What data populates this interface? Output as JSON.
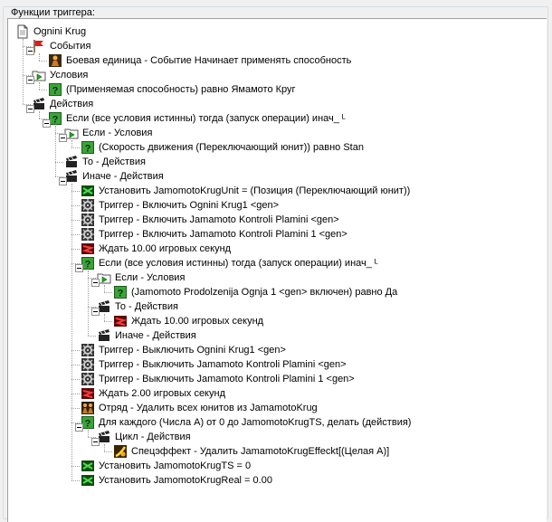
{
  "panel": {
    "title": "Функции триггера:"
  },
  "tree": [
    {
      "level": 0,
      "icon": "document-icon",
      "label": "Ognini Krug",
      "expandable": false
    },
    {
      "level": 1,
      "icon": "flag-icon",
      "label": "События",
      "expandable": true
    },
    {
      "level": 2,
      "icon": "unit-icon",
      "label": "Боевая единица - Событие Начинает применять способность",
      "expandable": false
    },
    {
      "level": 1,
      "icon": "condition-folder-icon",
      "label": "Условия",
      "expandable": true
    },
    {
      "level": 2,
      "icon": "question-icon",
      "label": "(Применяемая способность) равно Ямамото Круг",
      "expandable": false
    },
    {
      "level": 1,
      "icon": "clapper-icon",
      "label": "Действия",
      "expandable": true
    },
    {
      "level": 2,
      "icon": "question-icon",
      "label": "Если (все условия истинны) тогда (запуск операции) инач_ ᴸ",
      "expandable": true
    },
    {
      "level": 3,
      "icon": "condition-folder-icon",
      "label": "Если - Условия",
      "expandable": true
    },
    {
      "level": 4,
      "icon": "question-icon",
      "label": "(Скорость движения (Переключающий юнит)) равно Stan",
      "expandable": false
    },
    {
      "level": 3,
      "icon": "clapper-icon",
      "label": "То - Действия",
      "expandable": false
    },
    {
      "level": 3,
      "icon": "clapper-icon",
      "label": "Иначе - Действия",
      "expandable": true
    },
    {
      "level": 4,
      "icon": "set-variable-icon",
      "label": "Установить JamomotoKrugUnit = (Позиция (Переключающий юнит))",
      "expandable": false
    },
    {
      "level": 4,
      "icon": "gear-icon",
      "label": "Триггер - Включить Ognini Krug1 <gen>",
      "expandable": false
    },
    {
      "level": 4,
      "icon": "gear-icon",
      "label": "Триггер - Включить Jamamoto Kontroli Plamini <gen>",
      "expandable": false
    },
    {
      "level": 4,
      "icon": "gear-icon",
      "label": "Триггер - Включить Jamamoto Kontroli Plamini 1 <gen>",
      "expandable": false
    },
    {
      "level": 4,
      "icon": "wait-icon",
      "label": "Ждать 10.00 игровых секунд",
      "expandable": false
    },
    {
      "level": 4,
      "icon": "question-icon",
      "label": "Если (все условия истинны) тогда (запуск операции) инач_ ᴸ",
      "expandable": true
    },
    {
      "level": 5,
      "icon": "condition-folder-icon",
      "label": "Если - Условия",
      "expandable": true
    },
    {
      "level": 6,
      "icon": "question-icon",
      "label": "(Jamomoto Prodolzenija Ognja 1 <gen> включен) равно Да",
      "expandable": false
    },
    {
      "level": 5,
      "icon": "clapper-icon",
      "label": "То - Действия",
      "expandable": true
    },
    {
      "level": 6,
      "icon": "wait-icon",
      "label": "Ждать 10.00 игровых секунд",
      "expandable": false
    },
    {
      "level": 5,
      "icon": "clapper-icon",
      "label": "Иначе - Действия",
      "expandable": false
    },
    {
      "level": 4,
      "icon": "gear-icon",
      "label": "Триггер - Выключить Ognini Krug1 <gen>",
      "expandable": false
    },
    {
      "level": 4,
      "icon": "gear-icon",
      "label": "Триггер - Выключить Jamamoto Kontroli Plamini <gen>",
      "expandable": false
    },
    {
      "level": 4,
      "icon": "gear-icon",
      "label": "Триггер - Выключить Jamamoto Kontroli Plamini 1 <gen>",
      "expandable": false
    },
    {
      "level": 4,
      "icon": "wait-icon",
      "label": "Ждать 2.00 игровых секунд",
      "expandable": false
    },
    {
      "level": 4,
      "icon": "group-icon",
      "label": "Отряд - Удалить всех юнитов из JamamotoKrug",
      "expandable": false
    },
    {
      "level": 4,
      "icon": "question-icon",
      "label": "Для каждого (Числа А) от 0 до JamomotoKrugTS, делать (действия)",
      "expandable": true
    },
    {
      "level": 5,
      "icon": "clapper-icon",
      "label": "Цикл - Действия",
      "expandable": true
    },
    {
      "level": 6,
      "icon": "effect-icon",
      "label": "Спецэффект - Удалить JamamotoKrugEffeckt[(Целая А)]",
      "expandable": false
    },
    {
      "level": 4,
      "icon": "set-variable-icon",
      "label": "Установить JamomotoKrugTS = 0",
      "expandable": false
    },
    {
      "level": 4,
      "icon": "set-variable-icon",
      "label": "Установить JamomotoKrugReal = 0.00",
      "expandable": false
    }
  ]
}
